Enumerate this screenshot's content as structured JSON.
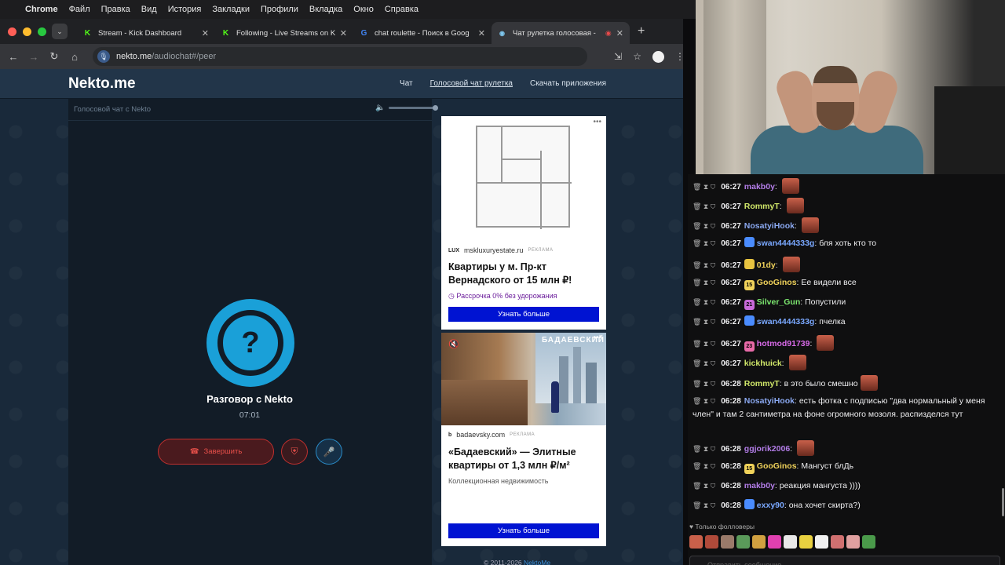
{
  "menubar": {
    "apple": "",
    "app": "Chrome",
    "items": [
      "Файл",
      "Правка",
      "Вид",
      "История",
      "Закладки",
      "Профили",
      "Вкладка",
      "Окно",
      "Справка"
    ]
  },
  "tabs": [
    {
      "label": "Stream - Kick Dashboard",
      "favicon": "K"
    },
    {
      "label": "Following - Live Streams on K",
      "favicon": "K"
    },
    {
      "label": "chat roulette - Поиск в Goog",
      "favicon": "G"
    },
    {
      "label": "Чат рулетка голосовая -",
      "favicon": "🎙"
    }
  ],
  "address": {
    "host": "nekto.me",
    "path": "/audiochat#/peer"
  },
  "nekto": {
    "logo": "Nekto.me",
    "nav": [
      "Чат",
      "Голосовой чат рулетка",
      "Скачать приложения"
    ],
    "panel_title": "Голосовой чат с Nekto",
    "conversation_title": "Разговор с Nekto",
    "timer": "07:01",
    "end_label": "Завершить",
    "question_mark": "?",
    "copyright": "© 2011-2026",
    "copyright_link": "NektoMe"
  },
  "ads": [
    {
      "source": "mskluxuryestate.ru",
      "source_logo": "LUX",
      "tag": "РЕКЛАМА",
      "headline": "Квартиры у м. Пр-кт Вернадского от 15 млн ₽!",
      "sub": "Рассрочка 0% без удорожания",
      "button": "Узнать больше",
      "sub_color": "#6a1b9a"
    },
    {
      "source": "badaevsky.com",
      "source_logo": "b",
      "tag": "РЕКЛАМА",
      "brand": "БАДАЕВСКИЙ",
      "headline": "«Бадаевский» — Элитные квартиры от 1,3 млн ₽/м²",
      "sub": "Коллекционная недвижимость",
      "button": "Узнать больше"
    }
  ],
  "chat": {
    "messages": [
      {
        "time": "06:27",
        "user": "makb0y",
        "color": "#b37de8",
        "text": "",
        "emote": true
      },
      {
        "time": "06:27",
        "user": "RommyT",
        "color": "#d1e86a",
        "text": "",
        "emote": true
      },
      {
        "time": "06:27",
        "user": "NosatyiHook",
        "color": "#8aa8f0",
        "text": "",
        "emote": true
      },
      {
        "time": "06:27",
        "user": "swan4444333g",
        "color": "#7aa8ff",
        "text": "бля хоть кто то",
        "badge": "#4a8cff"
      },
      {
        "time": "06:27",
        "user": "01dy",
        "color": "#f0d25a",
        "text": "",
        "emote": true,
        "badge": "#e8c440"
      },
      {
        "time": "06:27",
        "user": "GooGinos",
        "color": "#f0d25a",
        "text": "Ее видели все",
        "badge": "#f0d25a",
        "badge_text": "15"
      },
      {
        "time": "06:27",
        "user": "Silver_Gun",
        "color": "#7de870",
        "text": "Попустили",
        "badge": "#c86ad8",
        "badge_text": "21"
      },
      {
        "time": "06:27",
        "user": "swan4444333g",
        "color": "#7aa8ff",
        "text": "пчелка",
        "badge": "#4a8cff"
      },
      {
        "time": "06:27",
        "user": "hotmod91739",
        "color": "#d86ae8",
        "text": "",
        "emote": true,
        "badge": "#e86aa8",
        "badge_text": "23"
      },
      {
        "time": "06:27",
        "user": "kickhuick",
        "color": "#d1e86a",
        "text": "",
        "emote": true
      },
      {
        "time": "06:28",
        "user": "RommyT",
        "color": "#d1e86a",
        "text": "в это было смешно",
        "emote": true
      },
      {
        "time": "06:28",
        "user": "NosatyiHook",
        "color": "#8aa8f0",
        "text": "есть фотка с подписью \"два нормальный у меня член\" и там 2 сантиметра на фоне огромного мозоля. распизделся тут"
      },
      {
        "time": "06:28",
        "user": "ggjorik2006",
        "color": "#b37de8",
        "text": "",
        "emote": true
      },
      {
        "time": "06:28",
        "user": "GooGinos",
        "color": "#f0d25a",
        "text": "Мангуст блДь",
        "badge": "#f0d25a",
        "badge_text": "15"
      },
      {
        "time": "06:28",
        "user": "makb0y",
        "color": "#b37de8",
        "text": "реакция мангуста ))))"
      },
      {
        "time": "06:28",
        "user": "exxy90",
        "color": "#7aa8ff",
        "text": "она хочет скирта?)",
        "badge": "#4a8cff"
      }
    ],
    "followers_only": "Только фолловеры",
    "input_placeholder": "Отправить сообщение"
  }
}
